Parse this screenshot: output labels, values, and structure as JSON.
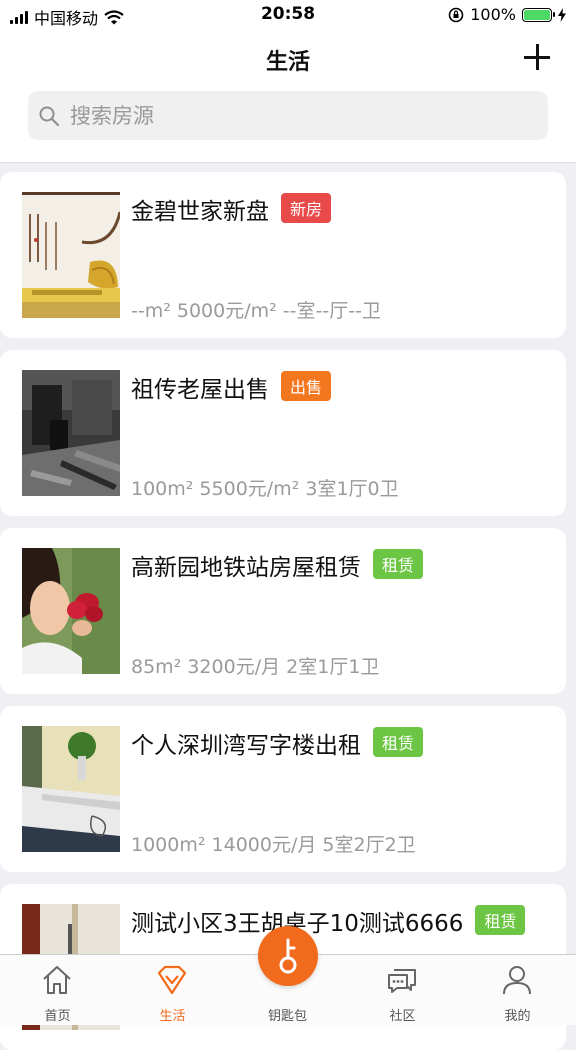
{
  "status": {
    "carrier": "中国移动",
    "time": "20:58",
    "battery": "100%"
  },
  "header": {
    "title": "生活"
  },
  "search": {
    "placeholder": "搜索房源"
  },
  "listings": [
    {
      "title": "金碧世家新盘",
      "tag": "新房",
      "tag_color": "#e84a4a",
      "meta": "--m² 5000元/m² --室--厅--卫",
      "image": "calligraphy-photo"
    },
    {
      "title": "祖传老屋出售",
      "tag": "出售",
      "tag_color": "#f3771e",
      "meta": "100m² 5500元/m² 3室1厅0卫",
      "image": "old-house-photo"
    },
    {
      "title": "高新园地铁站房屋租赁",
      "tag": "租赁",
      "tag_color": "#6cc644",
      "meta": "85m² 3200元/月 2室1厅1卫",
      "image": "portrait-photo"
    },
    {
      "title": "个人深圳湾写字楼出租",
      "tag": "租赁",
      "tag_color": "#6cc644",
      "meta": "1000m² 14000元/月 5室2厅2卫",
      "image": "office-photo"
    },
    {
      "title": "测试小区3王胡桌子10测试6666",
      "tag": "租赁",
      "tag_color": "#6cc644",
      "meta": "",
      "image": "door-photo"
    }
  ],
  "tabbar": {
    "items": [
      {
        "label": "首页",
        "icon": "home-icon"
      },
      {
        "label": "生活",
        "icon": "diamond-icon",
        "active": true
      },
      {
        "label": "钥匙包",
        "icon": "key-icon"
      },
      {
        "label": "社区",
        "icon": "chat-icon"
      },
      {
        "label": "我的",
        "icon": "person-icon"
      }
    ]
  },
  "colors": {
    "accent": "#f26b1d",
    "background": "#efeff4"
  }
}
